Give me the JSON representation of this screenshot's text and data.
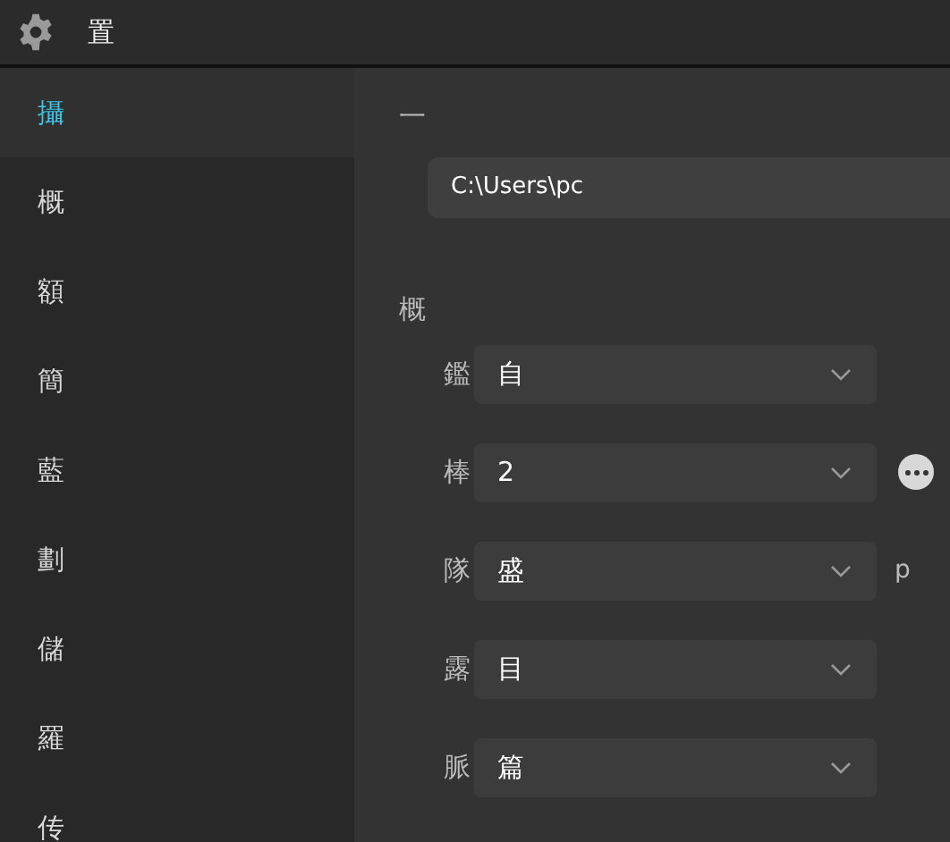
{
  "window": {
    "title": "置"
  },
  "sidebar": {
    "items": [
      {
        "label": "攝",
        "selected": true
      },
      {
        "label": "概",
        "selected": false
      },
      {
        "label": "額",
        "selected": false
      },
      {
        "label": "簡",
        "selected": false
      },
      {
        "label": "藍",
        "selected": false
      },
      {
        "label": "劃",
        "selected": false
      },
      {
        "label": "儲",
        "selected": false
      },
      {
        "label": "羅",
        "selected": false
      },
      {
        "label": "传",
        "selected": false
      }
    ]
  },
  "content": {
    "heading": "一",
    "path_field": {
      "value": "C:\\Users\\pc"
    },
    "section": "概",
    "rows": [
      {
        "label": "鑑",
        "value": "自"
      },
      {
        "label": "棒",
        "value": "2",
        "more_button": true
      },
      {
        "label": "隊",
        "value": "盛",
        "side_text": "p"
      },
      {
        "label": "露",
        "value": "目"
      },
      {
        "label": "脈",
        "value": "篇"
      }
    ]
  }
}
